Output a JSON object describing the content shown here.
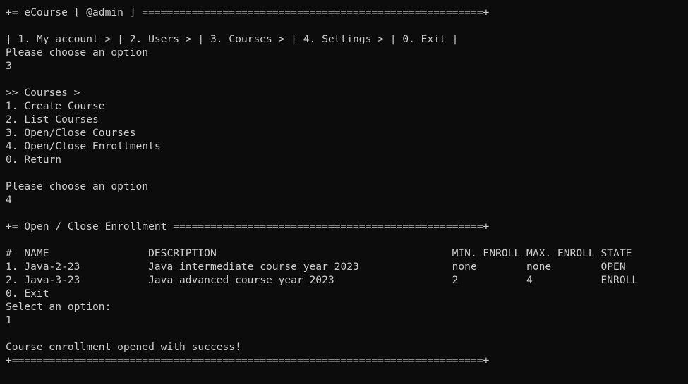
{
  "terminal": {
    "lines": [
      "+= eCourse [ @admin ] =======================================================+",
      "",
      "| 1. My account > | 2. Users > | 3. Courses > | 4. Settings > | 0. Exit |",
      "Please choose an option",
      "3",
      "",
      ">> Courses >",
      "1. Create Course",
      "2. List Courses",
      "3. Open/Close Courses",
      "4. Open/Close Enrollments",
      "0. Return",
      "",
      "Please choose an option",
      "4",
      "",
      "+= Open / Close Enrollment ==================================================+",
      "",
      "#  NAME                DESCRIPTION                                      MIN. ENROLL MAX. ENROLL STATE",
      "1. Java-2-23           Java intermediate course year 2023               none        none        OPEN",
      "2. Java-3-23           Java advanced course year 2023                   2           4           ENROLL",
      "0. Exit",
      "Select an option:",
      "1",
      "",
      "Course enrollment opened with success!",
      "+============================================================================+"
    ]
  }
}
